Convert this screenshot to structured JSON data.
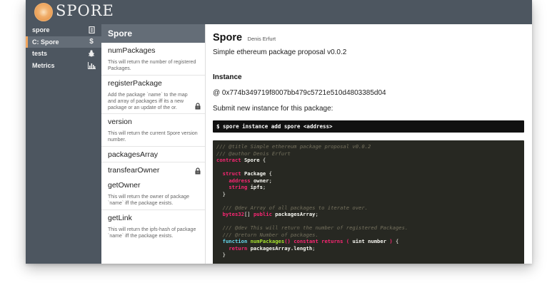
{
  "app": {
    "brand": "SPORE"
  },
  "sidebar": {
    "items": [
      {
        "label": "spore",
        "icon": "document-icon",
        "active": false
      },
      {
        "label": "C: Spore",
        "icon": "dollar-icon",
        "active": true
      },
      {
        "label": "tests",
        "icon": "bug-icon",
        "active": false
      },
      {
        "label": "Metrics",
        "icon": "bar-chart-icon",
        "active": false
      }
    ]
  },
  "list": {
    "header": "Spore",
    "items": [
      {
        "name": "numPackages",
        "desc": "This will return the number of registered Packages.",
        "locked": false
      },
      {
        "name": "registerPackage",
        "desc": "Add the package `name` to the map and array of packages iff its a new package or an update of the or.",
        "locked": true
      },
      {
        "name": "version",
        "desc": "This will return the current Spore version number.",
        "locked": false
      },
      {
        "name": "packagesArray",
        "desc": "",
        "locked": false
      },
      {
        "name": "transfearOwner",
        "desc": "",
        "locked": true
      },
      {
        "name": "getOwner",
        "desc": "This will return the owner of package `name` iff the package exists.",
        "locked": false
      },
      {
        "name": "getLink",
        "desc": "This will return the ipfs-hash of package `name` iff the package exists.",
        "locked": false
      }
    ]
  },
  "main": {
    "title": "Spore",
    "author": "Denis Erfurt",
    "subtitle": "Simple ethereum package proposal v0.0.2",
    "instance_heading": "Instance",
    "address": "@ 0x774b349719f8007bb479c5721e510d4803385d04",
    "submit_text": "Submit new instance for this package:",
    "command": "$ spore instance add spore <address>",
    "code_lines": [
      [
        [
          "c-com",
          "/// @title Simple ethereum package proposal v0.0.2"
        ]
      ],
      [
        [
          "c-com",
          "/// @author Denis Erfurt"
        ]
      ],
      [
        [
          "c-kw",
          "contract"
        ],
        [
          "c-pl",
          " "
        ],
        [
          "c-id",
          "Spore"
        ],
        [
          "c-pl",
          " {"
        ]
      ],
      [
        [
          "c-pl",
          ""
        ]
      ],
      [
        [
          "c-pl",
          "  "
        ],
        [
          "c-kw",
          "struct"
        ],
        [
          "c-pl",
          " "
        ],
        [
          "c-id",
          "Package"
        ],
        [
          "c-pl",
          " {"
        ]
      ],
      [
        [
          "c-pl",
          "    "
        ],
        [
          "c-kw",
          "address"
        ],
        [
          "c-pl",
          " "
        ],
        [
          "c-id",
          "owner"
        ],
        [
          "c-pl",
          ";"
        ]
      ],
      [
        [
          "c-pl",
          "    "
        ],
        [
          "c-kw",
          "string"
        ],
        [
          "c-pl",
          " "
        ],
        [
          "c-id",
          "ipfs"
        ],
        [
          "c-pl",
          ";"
        ]
      ],
      [
        [
          "c-pl",
          "  }"
        ]
      ],
      [
        [
          "c-pl",
          ""
        ]
      ],
      [
        [
          "c-pl",
          "  "
        ],
        [
          "c-com",
          "/// @dev Array of all packages to iterate over."
        ]
      ],
      [
        [
          "c-pl",
          "  "
        ],
        [
          "c-kw",
          "bytes32"
        ],
        [
          "c-pl",
          "[] "
        ],
        [
          "c-kw",
          "public"
        ],
        [
          "c-pl",
          " "
        ],
        [
          "c-id",
          "packagesArray"
        ],
        [
          "c-pl",
          ";"
        ]
      ],
      [
        [
          "c-pl",
          ""
        ]
      ],
      [
        [
          "c-pl",
          "  "
        ],
        [
          "c-com",
          "/// @dev This will return the number of registered Packages."
        ]
      ],
      [
        [
          "c-pl",
          "  "
        ],
        [
          "c-com",
          "/// @return Number of packages."
        ]
      ],
      [
        [
          "c-pl",
          "  "
        ],
        [
          "c-ty",
          "function"
        ],
        [
          "c-pl",
          " "
        ],
        [
          "c-fn",
          "numPackages"
        ],
        [
          "c-kw",
          "()"
        ],
        [
          "c-pl",
          " "
        ],
        [
          "c-kw",
          "constant"
        ],
        [
          "c-pl",
          " "
        ],
        [
          "c-kw",
          "returns"
        ],
        [
          "c-pl",
          " "
        ],
        [
          "c-kw",
          "("
        ],
        [
          "c-pl",
          " "
        ],
        [
          "c-id",
          "uint number"
        ],
        [
          "c-pl",
          " "
        ],
        [
          "c-kw",
          ")"
        ],
        [
          "c-pl",
          " {"
        ]
      ],
      [
        [
          "c-pl",
          "    "
        ],
        [
          "c-kw",
          "return"
        ],
        [
          "c-pl",
          " "
        ],
        [
          "c-id",
          "packagesArray.length"
        ],
        [
          "c-pl",
          ";"
        ]
      ],
      [
        [
          "c-pl",
          "  }"
        ]
      ]
    ]
  },
  "colors": {
    "topbar": "#4d5660",
    "sidebar_active": "#646d77",
    "accent": "#f0a660",
    "code_bg": "#272822"
  }
}
